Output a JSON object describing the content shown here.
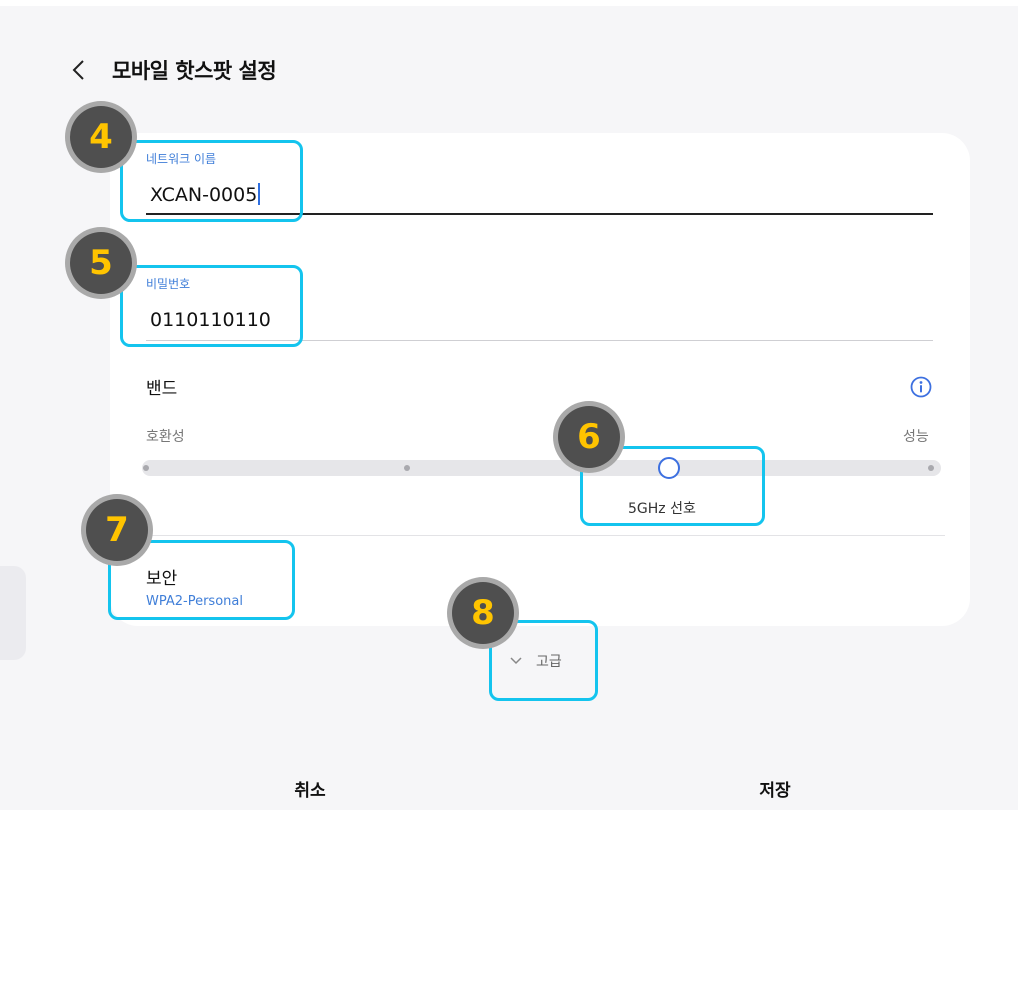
{
  "header": {
    "title": "모바일 핫스팟 설정"
  },
  "network_name": {
    "label": "네트워크 이름",
    "value": "XCAN-0005"
  },
  "password": {
    "label": "비밀번호",
    "value": "0110110110"
  },
  "band": {
    "title": "밴드",
    "min_label": "호환성",
    "max_label": "성능",
    "selected_label": "5GHz 선호",
    "selected_step": 3,
    "steps": 4
  },
  "security": {
    "title": "보안",
    "value": "WPA2-Personal"
  },
  "advanced": {
    "label": "고급"
  },
  "footer": {
    "cancel_label": "취소",
    "save_label": "저장"
  },
  "callouts": [
    "4",
    "5",
    "6",
    "7",
    "8"
  ],
  "colors": {
    "accent": "#3f7ed8",
    "highlight": "#14c4ee",
    "badge": "#4f4f4f",
    "badge_text": "#ffc400"
  }
}
